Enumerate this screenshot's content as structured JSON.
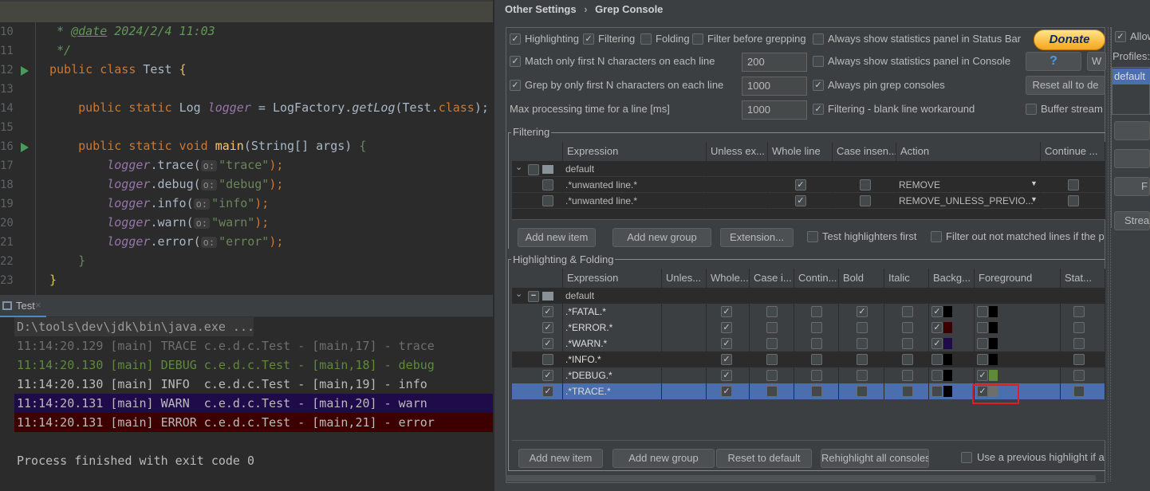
{
  "editor": {
    "lines": [
      {
        "n": "10",
        "tokens": [
          [
            " * ",
            "cm"
          ],
          [
            "@date",
            "tag"
          ],
          [
            " 2024/2/4 11:03",
            "cm"
          ]
        ]
      },
      {
        "n": "11",
        "tokens": [
          [
            " */",
            "cm"
          ]
        ]
      },
      {
        "n": "12",
        "run": true,
        "tokens": [
          [
            "public class ",
            "kw"
          ],
          [
            "Test ",
            ""
          ],
          [
            "{",
            "br"
          ]
        ]
      },
      {
        "n": "13",
        "tokens": []
      },
      {
        "n": "14",
        "tokens": [
          [
            "    public static ",
            "kw"
          ],
          [
            "Log ",
            ""
          ],
          [
            "logger",
            "it"
          ],
          [
            " = LogFactory.",
            ""
          ],
          [
            "getLog",
            "mi"
          ],
          [
            "(Test.",
            ""
          ],
          [
            "class",
            "kw"
          ],
          [
            ");",
            ""
          ]
        ]
      },
      {
        "n": "15",
        "tokens": []
      },
      {
        "n": "16",
        "run": true,
        "tokens": [
          [
            "    public static void ",
            "kw"
          ],
          [
            "main",
            "fn"
          ],
          [
            "(String[] args) ",
            ""
          ],
          [
            "{",
            "str"
          ]
        ]
      },
      {
        "n": "17",
        "tokens": [
          [
            "        ",
            ""
          ],
          [
            "logger",
            "it"
          ],
          [
            ".trace(",
            ""
          ],
          [
            "o:",
            "hint"
          ],
          [
            "\"trace\"",
            "str"
          ],
          [
            ");",
            "kw"
          ]
        ]
      },
      {
        "n": "18",
        "tokens": [
          [
            "        ",
            ""
          ],
          [
            "logger",
            "it"
          ],
          [
            ".debug(",
            ""
          ],
          [
            "o:",
            "hint"
          ],
          [
            "\"debug\"",
            "str"
          ],
          [
            ");",
            "kw"
          ]
        ]
      },
      {
        "n": "19",
        "tokens": [
          [
            "        ",
            ""
          ],
          [
            "logger",
            "it"
          ],
          [
            ".info(",
            ""
          ],
          [
            "o:",
            "hint"
          ],
          [
            "\"info\"",
            "str"
          ],
          [
            ");",
            "kw"
          ]
        ]
      },
      {
        "n": "20",
        "tokens": [
          [
            "        ",
            ""
          ],
          [
            "logger",
            "it"
          ],
          [
            ".warn(",
            ""
          ],
          [
            "o:",
            "hint"
          ],
          [
            "\"warn\"",
            "str"
          ],
          [
            ");",
            "kw"
          ]
        ]
      },
      {
        "n": "21",
        "tokens": [
          [
            "        ",
            ""
          ],
          [
            "logger",
            "it"
          ],
          [
            ".error(",
            ""
          ],
          [
            "o:",
            "hint"
          ],
          [
            "\"error\"",
            "str"
          ],
          [
            ");",
            "kw"
          ]
        ]
      },
      {
        "n": "22",
        "tokens": [
          [
            "    }",
            "str"
          ]
        ]
      },
      {
        "n": "23",
        "tokens": [
          [
            "}",
            "br"
          ]
        ]
      }
    ]
  },
  "run_tab": {
    "label": "Test"
  },
  "console": {
    "lines": [
      {
        "text": "D:\\tools\\dev\\jdk\\bin\\java.exe ...",
        "fg": "#9a9a9a",
        "bg": "#373737"
      },
      {
        "text": "11:14:20.129 [main] TRACE c.e.d.c.Test - [main,17] - trace",
        "fg": "#6e6e6e",
        "bg": ""
      },
      {
        "text": "11:14:20.130 [main] DEBUG c.e.d.c.Test - [main,18] - debug",
        "fg": "#5e8a3a",
        "bg": ""
      },
      {
        "text": "11:14:20.130 [main] INFO  c.e.d.c.Test - [main,19] - info",
        "fg": "#bbbbbb",
        "bg": ""
      },
      {
        "text": "11:14:20.131 [main] WARN  c.e.d.c.Test - [main,20] - warn",
        "fg": "#bbbbbb",
        "bg": "#1f0a4a"
      },
      {
        "text": "11:14:20.131 [main] ERROR c.e.d.c.Test - [main,21] - error",
        "fg": "#bbbbbb",
        "bg": "#3d0000"
      },
      {
        "text": "",
        "fg": "#bbbbbb",
        "bg": ""
      },
      {
        "text": "Process finished with exit code 0",
        "fg": "#bbbbbb",
        "bg": ""
      }
    ]
  },
  "settings": {
    "breadcrumb": [
      "Other Settings",
      "Grep Console"
    ],
    "options": {
      "highlighting": {
        "label": "Highlighting",
        "checked": true
      },
      "filtering": {
        "label": "Filtering",
        "checked": true
      },
      "folding": {
        "label": "Folding",
        "checked": false
      },
      "filter_before": {
        "label": "Filter before grepping",
        "checked": false
      },
      "stats_status": {
        "label": "Always show statistics panel in Status Bar",
        "checked": false
      },
      "match_first": {
        "label": "Match only first N characters on each line",
        "checked": true,
        "value": "200"
      },
      "stats_console": {
        "label": "Always show statistics panel in Console",
        "checked": false
      },
      "grep_first": {
        "label": "Grep by only first N characters on each line",
        "checked": true,
        "value": "1000"
      },
      "pin": {
        "label": "Always pin grep consoles",
        "checked": true
      },
      "max_time": {
        "label": "Max processing time for a line [ms]",
        "value": "1000"
      },
      "blank_workaround": {
        "label": "Filtering - blank line workaround",
        "checked": true
      },
      "buffer": {
        "label": "Buffer stream",
        "checked": false
      }
    },
    "donate": "Donate",
    "help": "?",
    "w_btn": "W",
    "reset_all": "Reset all to de",
    "filtering": {
      "legend": "Filtering",
      "columns": [
        "",
        "Expression",
        "Unless ex...",
        "Whole line",
        "Case insen...",
        "Action",
        "Continue ..."
      ],
      "group": "default",
      "rows": [
        {
          "enabled": false,
          "expression": ".*unwanted line.*",
          "whole": true,
          "case": false,
          "action": "REMOVE",
          "cont": false
        },
        {
          "enabled": false,
          "expression": ".*unwanted line.*",
          "whole": true,
          "case": false,
          "action": "REMOVE_UNLESS_PREVIO...",
          "cont": false
        }
      ],
      "buttons": [
        "Add new item",
        "Add new group",
        "Extension..."
      ],
      "test_first": {
        "label": "Test highlighters first",
        "checked": false
      },
      "filter_out": {
        "label": "Filter out not matched lines if the p",
        "checked": false
      }
    },
    "highlighting": {
      "legend": "Highlighting & Folding",
      "columns": [
        "",
        "Expression",
        "Unles...",
        "Whole...",
        "Case i...",
        "Contin...",
        "Bold",
        "Italic",
        "Backg...",
        "Foreground",
        "Stat..."
      ],
      "group": "default",
      "rows": [
        {
          "enabled": true,
          "expression": ".*FATAL.*",
          "whole": true,
          "bold": true,
          "bg_on": true,
          "bg": "#000000",
          "fg_on": false,
          "fg": "#000000"
        },
        {
          "enabled": true,
          "expression": ".*ERROR.*",
          "whole": true,
          "bold": false,
          "bg_on": true,
          "bg": "#3d0000",
          "fg_on": false,
          "fg": "#000000"
        },
        {
          "enabled": true,
          "expression": ".*WARN.*",
          "whole": true,
          "bold": false,
          "bg_on": true,
          "bg": "#1f0a4a",
          "fg_on": false,
          "fg": "#000000"
        },
        {
          "enabled": false,
          "expression": ".*INFO.*",
          "whole": true,
          "bold": false,
          "bg_on": false,
          "bg": "#000000",
          "fg_on": false,
          "fg": "#000000"
        },
        {
          "enabled": true,
          "expression": ".*DEBUG.*",
          "whole": true,
          "bold": false,
          "bg_on": false,
          "bg": "#000000",
          "fg_on": true,
          "fg": "#5e8a3a"
        },
        {
          "enabled": true,
          "expression": ".*TRACE.*",
          "whole": true,
          "bold": false,
          "bg_on": false,
          "bg": "#000000",
          "fg_on": true,
          "fg": "#6e6e6e",
          "selected": true
        }
      ],
      "buttons": [
        "Add new item",
        "Add new group",
        "Reset to default",
        "Rehighlight all consoles"
      ],
      "use_previous": {
        "label": "Use a previous highlight if a",
        "checked": false
      }
    },
    "profiles": {
      "allow_label": "Allow",
      "allow_checked": true,
      "label": "Profiles:",
      "items": [
        "default"
      ],
      "stream_btn": "Strea",
      "f_btn": "F"
    }
  },
  "colors": {
    "selection": "#4b6eaf",
    "accent_highlight": "#ff2020"
  }
}
